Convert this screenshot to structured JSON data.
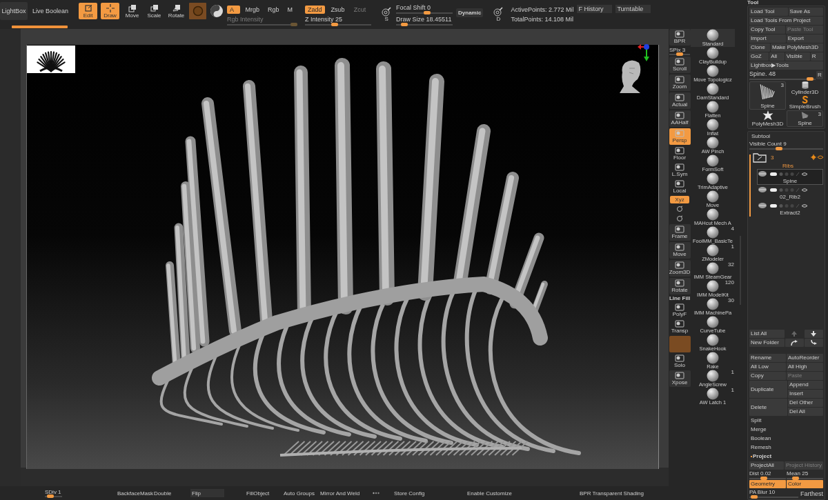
{
  "top_bar": {
    "lightbox": "LightBox",
    "live_boolean": "Live Boolean",
    "transform_modes": [
      {
        "label": "Edit",
        "kind": "edit",
        "selected": true
      },
      {
        "label": "Draw",
        "kind": "draw",
        "selected": true
      },
      {
        "label": "Move",
        "kind": "move",
        "selected": false
      },
      {
        "label": "Scale",
        "kind": "scale",
        "selected": false
      },
      {
        "label": "Rotate",
        "kind": "rotate",
        "selected": false
      }
    ],
    "color_modes": [
      {
        "label": "A",
        "selected": true
      },
      {
        "label": "Mrgb",
        "selected": false
      },
      {
        "label": "Rgb",
        "selected": false
      },
      {
        "label": "M",
        "selected": false
      }
    ],
    "rgb_intensity": {
      "label": "Rgb Intensity",
      "level": 0.95,
      "disabled": true
    },
    "depth_modes": [
      {
        "label": "Zadd",
        "selected": true,
        "disabled": false
      },
      {
        "label": "Zsub",
        "selected": false,
        "disabled": false
      },
      {
        "label": "Zcut",
        "selected": false,
        "disabled": true
      }
    ],
    "z_intensity": {
      "label": "Z Intensity 25",
      "level": 0.45
    },
    "stroke_letter": "S",
    "focal_shift": {
      "label": "Focal Shift 0",
      "level": 0.55
    },
    "draw_size": {
      "label": "Draw Size 18.45511",
      "level": 0.15
    },
    "dynamic": "Dynamic",
    "alpha_letter": "D",
    "active_points": "ActivePoints: 2.772 Mil",
    "total_points": "TotalPoints: 14.108 Mil",
    "f_history": "F History",
    "turntable": "Turntable"
  },
  "shelf": [
    {
      "label": "BPR",
      "kind": "button",
      "selected": false
    },
    {
      "label": "SPix 3",
      "kind": "slider",
      "level": 0.5
    },
    {
      "label": "Scroll",
      "kind": "button",
      "selected": false
    },
    {
      "label": "Zoom",
      "kind": "button",
      "selected": false
    },
    {
      "label": "Actual",
      "kind": "button",
      "selected": false
    },
    {
      "label": "AAHalf",
      "kind": "button",
      "selected": false
    },
    {
      "label": "Persp",
      "kind": "button",
      "selected": true
    },
    {
      "label": "Floor",
      "kind": "flat",
      "selected": false
    },
    {
      "label": "L.Sym",
      "kind": "flat",
      "selected": false
    },
    {
      "label": "Local",
      "kind": "flat",
      "selected": false
    },
    {
      "label": "Xyz",
      "kind": "chip",
      "selected": true
    },
    {
      "kind": "rotate",
      "selected": false
    },
    {
      "kind": "rotate",
      "selected": false
    },
    {
      "label": "Frame",
      "kind": "button",
      "selected": false
    },
    {
      "label": "Move",
      "kind": "button",
      "selected": false
    },
    {
      "label": "Zoom3D",
      "kind": "button",
      "selected": false
    },
    {
      "label": "Rotate",
      "kind": "button",
      "selected": false
    },
    {
      "label": "PolyF",
      "caption": "Line Fill",
      "kind": "flat",
      "selected": false
    },
    {
      "label": "Transp",
      "kind": "flat",
      "selected": false
    },
    {
      "kind": "tinted",
      "selected": false
    },
    {
      "label": "Solo",
      "kind": "flat",
      "selected": false
    },
    {
      "label": "Xpose",
      "kind": "button",
      "selected": false
    }
  ],
  "brushes": [
    {
      "name": "Standard",
      "selected": true
    },
    {
      "name": "ClayBuildup",
      "selected": false
    },
    {
      "name": "Move Topologicz",
      "selected": false
    },
    {
      "name": "DamStandard",
      "selected": false
    },
    {
      "name": "Flatten",
      "selected": false
    },
    {
      "name": "Inflat",
      "selected": false
    },
    {
      "name": "AW Pinch",
      "selected": false
    },
    {
      "name": "FormSoft",
      "selected": false
    },
    {
      "name": "TrimAdaptive",
      "selected": false
    },
    {
      "name": "Move",
      "selected": false
    },
    {
      "name": "MAHcut Mech A",
      "selected": false
    },
    {
      "name": "FooIMM_BasicTe",
      "count": "4",
      "selected": false
    },
    {
      "name": "ZModeler",
      "count": "1",
      "selected": false
    },
    {
      "name": "IMM SteamGear",
      "count": "32",
      "selected": false
    },
    {
      "name": "IMM ModelKit",
      "count": "120",
      "selected": false
    },
    {
      "name": "IMM MachinePa",
      "count": "30",
      "selected": false
    },
    {
      "name": "CurveTube",
      "selected": false
    },
    {
      "name": "SnakeHook",
      "selected": false
    },
    {
      "name": "Rake",
      "selected": false
    },
    {
      "name": "AngleScrew",
      "count": "1",
      "selected": false
    },
    {
      "name": "AW Latch 1",
      "count": "1",
      "selected": false
    }
  ],
  "tool_panel": {
    "title": "Tool",
    "button_rows": [
      [
        {
          "label": "Load Tool",
          "disabled": false
        },
        {
          "label": "Save As",
          "disabled": false
        }
      ],
      [
        {
          "label": "Load Tools From Project",
          "disabled": false
        }
      ],
      [
        {
          "label": "Copy Tool",
          "disabled": false
        },
        {
          "label": "Paste Tool",
          "disabled": true
        }
      ],
      [
        {
          "label": "Import",
          "disabled": false
        },
        {
          "label": "Export",
          "disabled": false
        }
      ],
      [
        {
          "label": "Clone",
          "disabled": false
        },
        {
          "label": "Make PolyMesh3D",
          "disabled": false
        }
      ],
      [
        {
          "label": "GoZ",
          "disabled": false
        },
        {
          "label": "All",
          "disabled": false
        },
        {
          "label": "Visible",
          "disabled": false
        },
        {
          "label": "R",
          "disabled": false
        }
      ],
      [
        {
          "label": "Lightbox▶Tools",
          "disabled": false
        }
      ]
    ],
    "tool_slider": {
      "label": "Spine. 48",
      "level": 0.92
    },
    "tool_slider_button": "R",
    "tools": [
      {
        "name": "Spine",
        "count": "3",
        "kind": "spine",
        "large": true,
        "selected": true
      },
      {
        "name": "Cylinder3D",
        "kind": "cylinder",
        "large": false,
        "selected": false
      },
      {
        "name": "SimpleBrush",
        "kind": "simple_brush",
        "large": false,
        "selected": false
      },
      {
        "name": "PolyMesh3D",
        "kind": "star",
        "large": false,
        "selected": false
      },
      {
        "name": "Spine",
        "count": "3",
        "kind": "spine",
        "large": false,
        "selected": true
      }
    ]
  },
  "subtool": {
    "title": "Subtool",
    "visible_count": {
      "label": "Visible Count 9",
      "level": 0.4
    },
    "folder": {
      "count": "3",
      "name": "Ribs"
    },
    "items": [
      {
        "name": "Spine",
        "selected": true
      },
      {
        "name": "02_Rib2",
        "selected": false
      },
      {
        "name": "Extract2",
        "selected": false
      }
    ],
    "list_all": "List All",
    "new_folder": "New Folder",
    "action_rows": [
      [
        {
          "label": "Rename",
          "disabled": false
        },
        {
          "label": "AutoReorder",
          "disabled": false
        }
      ],
      [
        {
          "label": "All Low",
          "disabled": false
        },
        {
          "label": "All High",
          "disabled": false
        }
      ],
      [
        {
          "label": "Copy",
          "disabled": false
        },
        {
          "label": "Paste",
          "disabled": true
        }
      ]
    ],
    "duplicate": {
      "label": "Duplicate",
      "options": [
        "Append",
        "Insert"
      ]
    },
    "delete": {
      "label": "Delete",
      "options": [
        "Del Other",
        "Del All"
      ]
    },
    "sections": [
      "Split",
      "Merge",
      "Boolean",
      "Remesh"
    ]
  },
  "project": {
    "title": "Project",
    "buttons": [
      {
        "label": "ProjectAll",
        "disabled": false
      },
      {
        "label": "Project History",
        "disabled": true
      }
    ],
    "sliders": [
      {
        "label": "Dist 0.02",
        "level": 0.4
      },
      {
        "label": "Mean 25",
        "level": 0.25
      }
    ],
    "modes": [
      {
        "label": "Geometry",
        "selected": true
      },
      {
        "label": "Color",
        "selected": true
      }
    ],
    "pa_blur": {
      "label": "PA Blur 10",
      "level": 0.1
    },
    "farthest": "Farthest"
  },
  "bottom_bar": {
    "sdiv": {
      "label": "SDiv 1",
      "level": 0.3
    },
    "buttons": [
      {
        "label": "BackfaceMask",
        "kind": "plain"
      },
      {
        "label": "Double",
        "kind": "plain"
      },
      {
        "label": "Flip",
        "kind": "boxed"
      },
      {
        "label": "FillObject",
        "kind": "plain"
      },
      {
        "label": "Auto Groups",
        "kind": "plain"
      },
      {
        "label": "Mirror And Weld",
        "kind": "plain"
      }
    ],
    "buttons_after": [
      {
        "label": "Store Config",
        "kind": "plain"
      },
      {
        "label": "Enable Customize",
        "kind": "plain"
      },
      {
        "label": "BPR Transparent Shading",
        "kind": "plain"
      }
    ]
  }
}
